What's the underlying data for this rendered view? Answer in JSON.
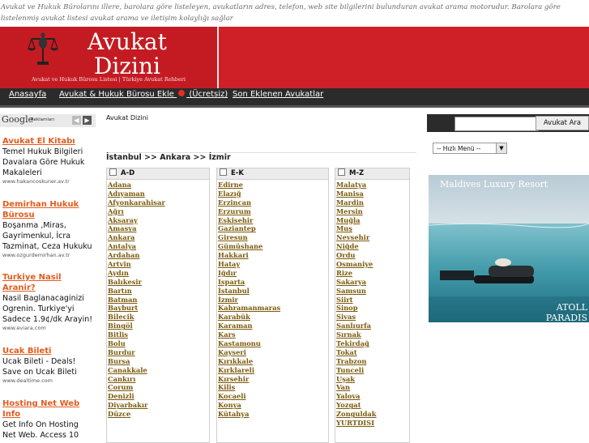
{
  "top_description": "Avukat ve Hukuk Bürolarını illere, barolara göre listeleyen, avukatların adres, telefon, web site bilgilerini bulunduran avukat arama motorudur. Barolara göre listelenmiş avukat listesi avukat arama ve iletişim kolaylığı sağlar",
  "logo": {
    "line1": "Avukat",
    "line2": "Dizini",
    "subtitle": "Avukat ve Hukuk Bürosu Listesi | Türkiye Avukat Rehberi"
  },
  "nav": {
    "home": "Anasayfa",
    "add_office": "Avukat & Hukuk Bürosu Ekle",
    "add_badge": "(Ücretsiz)",
    "recent": "Son Eklenen Avukatlar"
  },
  "google": {
    "brand": "Google",
    "label": "Reklamları"
  },
  "ads": [
    {
      "title": "Avukat El Kitabı",
      "body": "Temel Hukuk Bilgileri Davalara Göre Hukuk Makaleleri",
      "url": "www.hakancoskuner.av.tr"
    },
    {
      "title": "Demirhan Hukuk Bürosu",
      "body": "Boşanma ,Miras, Gayrimenkul, İcra Tazminat, Ceza Hukuku",
      "url": "www.ozgurdemirhan.av.tr"
    },
    {
      "title": "Turkiye Nasil Aranir?",
      "body": "Nasil Baglanacaginizi Ogrenin. Turkiye'yi Sadece 1.9¢/dk Arayin!",
      "url": "www.eviara.com"
    },
    {
      "title": "Ucak Bileti",
      "body": "Ucak Bileti - Deals! Save on Ucak Bileti",
      "url": "www.dealtime.com"
    },
    {
      "title": "Hosting Net Web Info",
      "body": "Get Info On Hosting Net Web. Access 10",
      "url": ""
    }
  ],
  "breadcrumb": "Avukat Dizini",
  "major_cities": "İstanbul >> Ankara >> İzmir",
  "columns": [
    {
      "head": "A-D",
      "cities": [
        "Adana",
        "Adıyaman",
        "Afyonkarahisar",
        "Ağrı",
        "Aksaray",
        "Amasya",
        "Ankara",
        "Antalya",
        "Ardahan",
        "Artvin",
        "Aydın",
        "Balıkesir",
        "Bartın",
        "Batman",
        "Bayburt",
        "Bilecik",
        "Bingöl",
        "Bitlis",
        "Bolu",
        "Burdur",
        "Bursa",
        "Canakkale",
        "Cankırı",
        "Corum",
        "Denizli",
        "Diyarbakır",
        "Düzce"
      ]
    },
    {
      "head": "E-K",
      "cities": [
        "Edirne",
        "Elazığ",
        "Erzincan",
        "Erzurum",
        "Eskisehir",
        "Gaziantep",
        "Giresun",
        "Gümüshane",
        "Hakkari",
        "Hatay",
        "Iğdır",
        "Isparta",
        "İstanbul",
        "İzmir",
        "Kahramanmaras",
        "Karabük",
        "Karaman",
        "Kars",
        "Kastamonu",
        "Kayseri",
        "Kırıkkale",
        "Kırklareli",
        "Kırsehir",
        "Kilis",
        "Kocaeli",
        "Konya",
        "Kütahya"
      ]
    },
    {
      "head": "M-Z",
      "cities": [
        "Malatya",
        "Manisa",
        "Mardin",
        "Mersin",
        "Muğla",
        "Muş",
        "Nevsehir",
        "Niğde",
        "Ordu",
        "Osmaniye",
        "Rize",
        "Sakarya",
        "Samsun",
        "Siirt",
        "Sinop",
        "Sivas",
        "Sanlıurfa",
        "Sırnak",
        "Tekirdağ",
        "Tokat",
        "Trabzon",
        "Tunceli",
        "Uşak",
        "Van",
        "Yalova",
        "Yozgat",
        "Zonguldak",
        "YURTDISI"
      ]
    }
  ],
  "search": {
    "placeholder": "",
    "button": "Avukat Ara"
  },
  "quick_menu": "-- Hızlı Menü --",
  "promo": {
    "headline": "Maldives Luxury Resort",
    "brand_line1": "ATOLL",
    "brand_line2": "PARADIS"
  },
  "colors": {
    "header_red": "#cf2028",
    "nav_dark": "#2b2b2b",
    "link_gold": "#7a5a0b",
    "ad_orange": "#e55b1d"
  }
}
